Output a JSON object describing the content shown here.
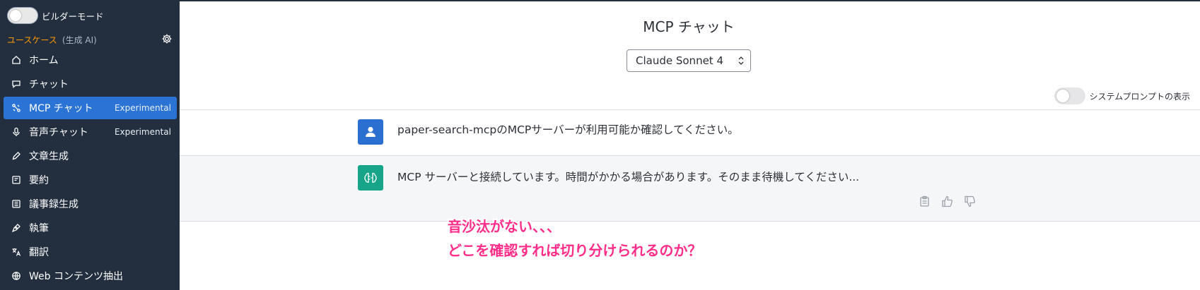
{
  "sidebar": {
    "builder_mode_label": "ビルダーモード",
    "section_title": "ユースケース",
    "section_sub": "(生成 AI)",
    "items": [
      {
        "label": "ホーム",
        "badge": "",
        "icon": "home-icon"
      },
      {
        "label": "チャット",
        "badge": "",
        "icon": "chat-icon"
      },
      {
        "label": "MCP チャット",
        "badge": "Experimental",
        "icon": "mcp-icon",
        "active": true
      },
      {
        "label": "音声チャット",
        "badge": "Experimental",
        "icon": "microphone-icon"
      },
      {
        "label": "文章生成",
        "badge": "",
        "icon": "pencil-icon"
      },
      {
        "label": "要約",
        "badge": "",
        "icon": "summary-icon"
      },
      {
        "label": "議事録生成",
        "badge": "",
        "icon": "minutes-icon"
      },
      {
        "label": "執筆",
        "badge": "",
        "icon": "writing-icon"
      },
      {
        "label": "翻訳",
        "badge": "",
        "icon": "translate-icon"
      },
      {
        "label": "Web コンテンツ抽出",
        "badge": "",
        "icon": "globe-icon"
      }
    ]
  },
  "main": {
    "title": "MCP チャット",
    "model_select": "Claude Sonnet 4",
    "system_prompt_label": "システムプロンプトの表示",
    "messages": [
      {
        "role": "user",
        "text": "paper-search-mcpのMCPサーバーが利用可能か確認してください。"
      },
      {
        "role": "assistant",
        "text": "MCP サーバーと接続しています。時間がかかる場合があります。そのまま待機してください..."
      }
    ]
  },
  "annotation": {
    "line1": "音沙汰がない、、、",
    "line2": "どこを確認すれば切り分けられるのか？"
  },
  "colors": {
    "sidebar_bg": "#232f3e",
    "active_item": "#2b74d5",
    "accent_orange": "#ff9900",
    "annotation_pink": "#ff2d8a",
    "bot_avatar": "#17a58a",
    "user_avatar": "#2b6fd1"
  }
}
